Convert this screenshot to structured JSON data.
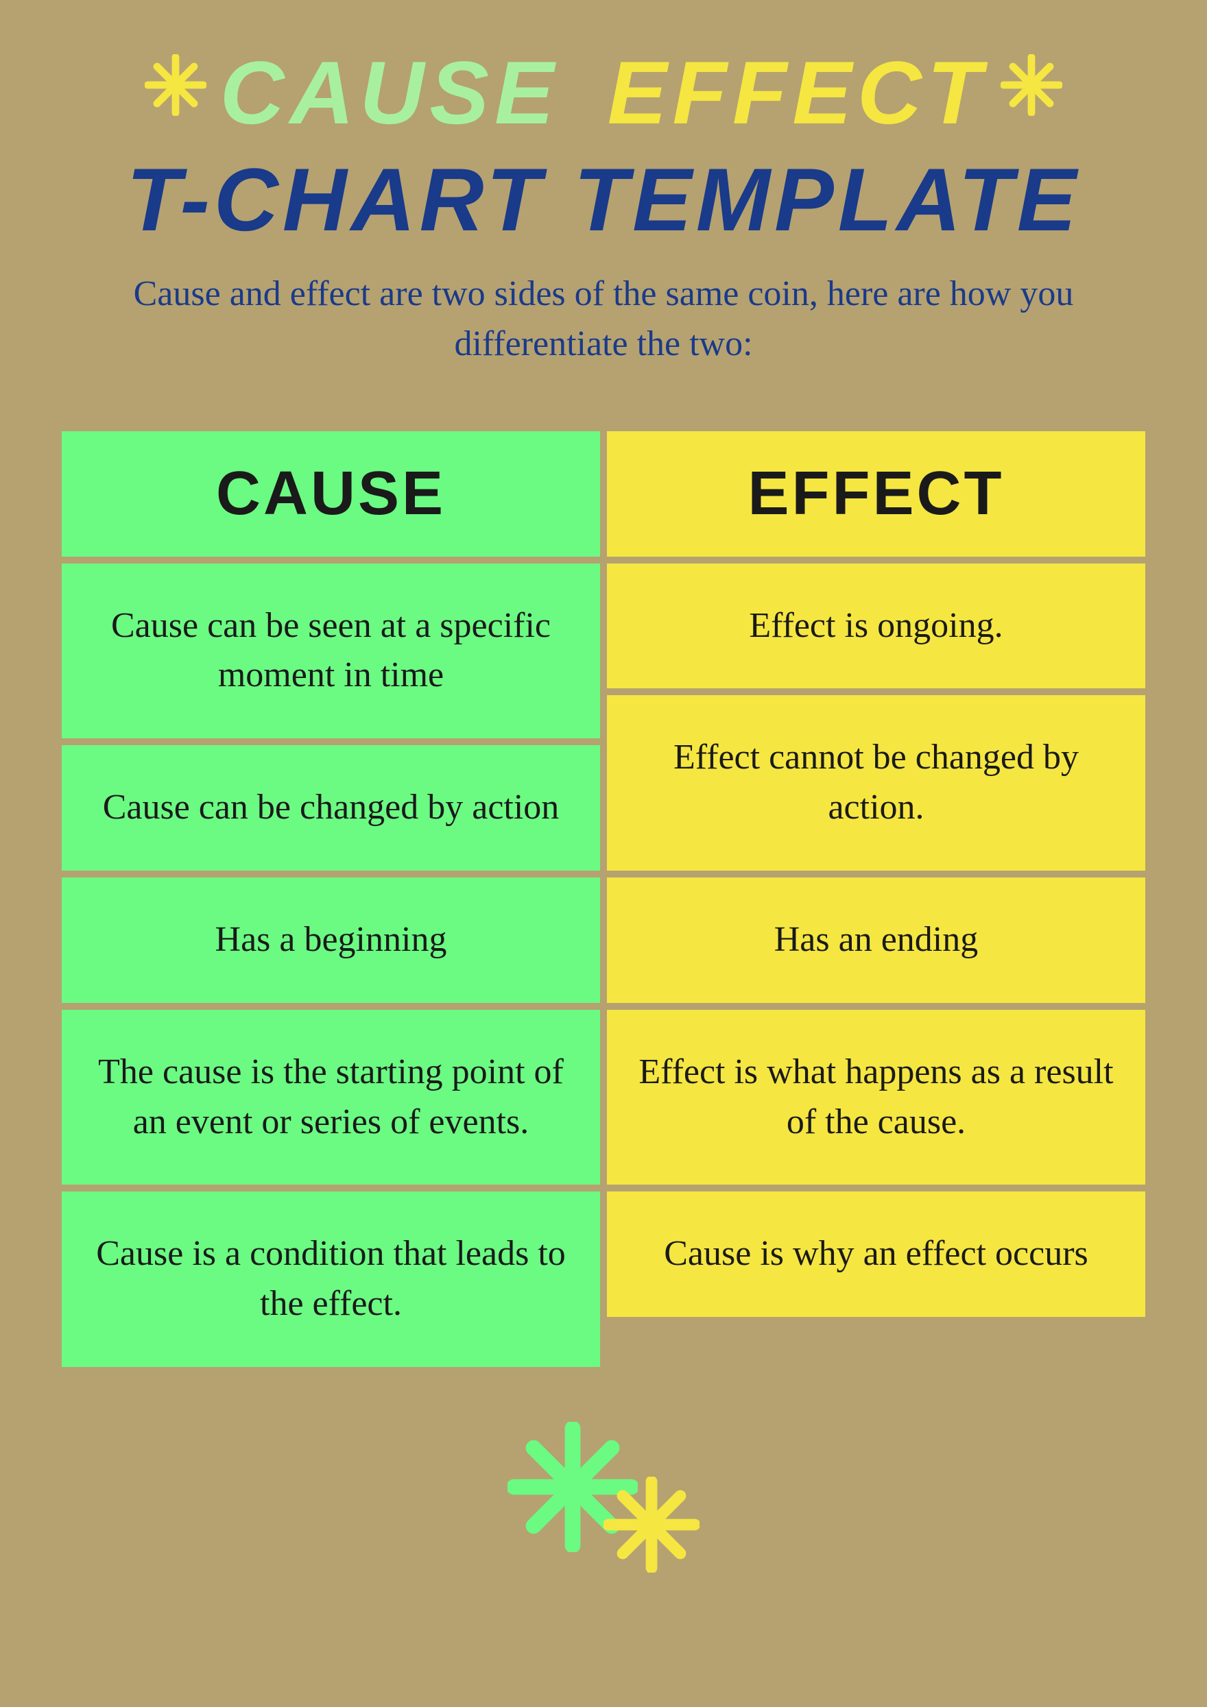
{
  "header": {
    "title_line1_cause": "CAUSE",
    "title_line1_effect": "EFFECT",
    "title_line2": "T-CHART TEMPLATE",
    "subtitle": "Cause and effect are two sides of the same coin, here are how you differentiate the two:",
    "star_left": "✳",
    "star_right": "✳"
  },
  "chart": {
    "col1_header": "CAUSE",
    "col2_header": "EFFECT",
    "rows": [
      {
        "cause": "Cause can be seen at a specific moment in time",
        "effect": "Effect is ongoing."
      },
      {
        "cause": "Cause can be changed by action",
        "effect": "Effect cannot be changed by action."
      },
      {
        "cause": "Has a beginning",
        "effect": "Has an ending"
      },
      {
        "cause": "The cause is the starting point of an event or series of events.",
        "effect": "Effect is what happens as a result of the cause."
      },
      {
        "cause": "Cause is a condition that leads to the effect.",
        "effect": "Cause is why an effect occurs"
      }
    ]
  },
  "decoration": {
    "bottom_star_green": "✳",
    "bottom_star_yellow": "✳"
  }
}
